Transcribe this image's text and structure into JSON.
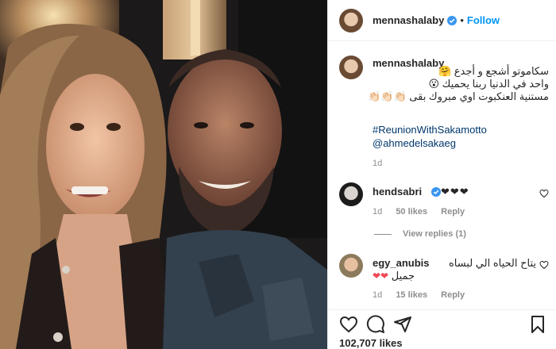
{
  "post": {
    "author": "mennashalaby",
    "separator": "•",
    "follow_label": "Follow",
    "caption_lines": [
      "سكاموتو أشجع و أجدع 🤗",
      "واحد في الدنيا ربنا يحميك 😮",
      "مستنية العنكبوت اوي مبروك بقى 👏🏻👏🏻👏🏻"
    ],
    "hashtag": "#ReunionWithSakamotto",
    "mention": "@ahmedelsakaeg",
    "time": "1d",
    "likes": "102,707 likes"
  },
  "comments": [
    {
      "username": "hendsabri",
      "text": "",
      "hearts": "❤❤❤",
      "time": "1d",
      "likes": "50 likes",
      "reply_label": "Reply",
      "view_replies": "View replies (1)"
    },
    {
      "username": "egy_anubis",
      "text": "يتاح الحياه الي لبساه",
      "text2": "جميل",
      "hearts": "❤❤",
      "time": "1d",
      "likes": "15 likes",
      "reply_label": "Reply"
    }
  ],
  "icons": [
    "verified-badge-icon",
    "heart-icon",
    "comment-icon",
    "share-icon",
    "bookmark-icon"
  ],
  "colors": {
    "accent": "#0095f6",
    "text": "#262626",
    "muted": "#8e8e8e",
    "hashtag": "#00376b",
    "heart": "#ed4956"
  }
}
